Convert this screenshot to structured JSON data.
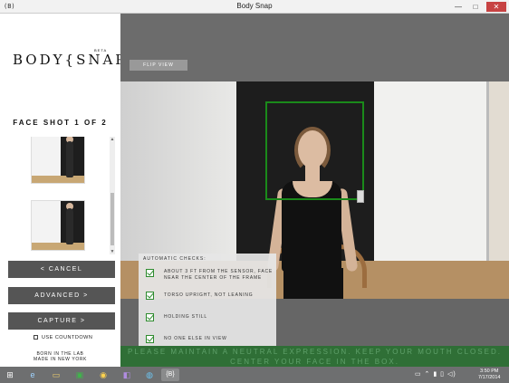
{
  "window": {
    "title": "Body Snap",
    "app_icon": "(B)",
    "minimize": "—",
    "maximize": "□",
    "close": "✕"
  },
  "sidebar": {
    "logo": "BODY{SNAP}",
    "beta": "BETA",
    "face_shot_label": "FACE SHOT 1 OF 2",
    "cancel_label": "< CANCEL",
    "advanced_label": "ADVANCED >",
    "capture_label": "CAPTURE >",
    "countdown_label": "USE COUNTDOWN",
    "countdown_checked": false,
    "born_line1": "BORN IN THE LAB",
    "born_line2": "MADE IN NEW YORK"
  },
  "camera": {
    "flip_label": "FLIP VIEW"
  },
  "checks": {
    "header": "AUTOMATIC CHECKS:",
    "items": [
      {
        "text": "ABOUT 3 FT FROM THE SENSOR, FACE NEAR THE CENTER OF THE FRAME",
        "checked": true
      },
      {
        "text": "TORSO UPRIGHT, NOT LEANING",
        "checked": true
      },
      {
        "text": "HOLDING STILL",
        "checked": true
      },
      {
        "text": "NO ONE ELSE IN VIEW",
        "checked": true
      }
    ]
  },
  "banner": {
    "line1": "PLEASE MAINTAIN A NEUTRAL EXPRESSION. KEEP YOUR MOUTH CLOSED.",
    "line2": "CENTER YOUR FACE IN THE BOX."
  },
  "taskbar": {
    "items": [
      {
        "name": "start-button-icon",
        "glyph": "⊞"
      },
      {
        "name": "internet-explorer-icon",
        "glyph": "e"
      },
      {
        "name": "file-explorer-icon",
        "glyph": "▭"
      },
      {
        "name": "store-icon",
        "glyph": "▣"
      },
      {
        "name": "chrome-icon",
        "glyph": "◉"
      },
      {
        "name": "visual-studio-icon",
        "glyph": "◧"
      },
      {
        "name": "globe-icon",
        "glyph": "◍"
      },
      {
        "name": "bodysnap-app-icon",
        "glyph": "{B}"
      }
    ],
    "tray": "▭ ⌃ ▮ ▯ ◁)",
    "time": "3:50 PM",
    "date": "7/17/2014"
  },
  "colors": {
    "accent_green": "#2e8b2e",
    "face_box_green": "#1a8a1a",
    "banner_green": "#2f6f36",
    "button_gray": "#555555"
  }
}
